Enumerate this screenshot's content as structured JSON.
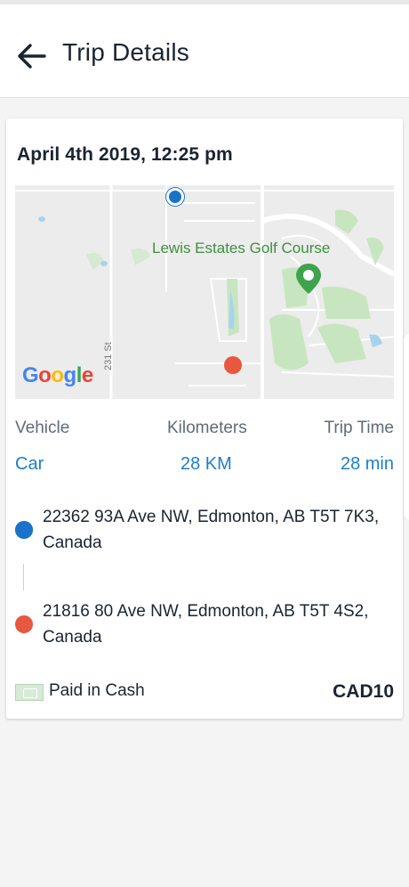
{
  "header": {
    "title": "Trip Details",
    "back_icon": "arrow-left-icon"
  },
  "trip": {
    "date": "April 4th 2019, 12:25 pm",
    "map": {
      "poi_label": "Lewis Estates Golf Course",
      "street_label": "231 St",
      "logo": [
        "G",
        "o",
        "o",
        "g",
        "l",
        "e"
      ],
      "logo_colors": [
        "#4285F4",
        "#EA4335",
        "#FBBC05",
        "#4285F4",
        "#34A853",
        "#EA4335"
      ]
    },
    "stats": {
      "vehicle_label": "Vehicle",
      "vehicle_value": "Car",
      "distance_label": "Kilometers",
      "distance_value": "28 KM",
      "time_label": "Trip Time",
      "time_value": "28 min"
    },
    "pickup": {
      "line1": "22362 93A Ave NW, Edmonton, AB T5T 7K3,",
      "line2": "Canada",
      "color": "#1a73c9"
    },
    "dropoff": {
      "line1": "21816 80 Ave NW, Edmonton, AB T5T 4S2,",
      "line2": "Canada",
      "color": "#e8573f"
    },
    "payment": {
      "method": "Paid in Cash",
      "icon": "cash-icon",
      "amount": "CAD10"
    }
  }
}
